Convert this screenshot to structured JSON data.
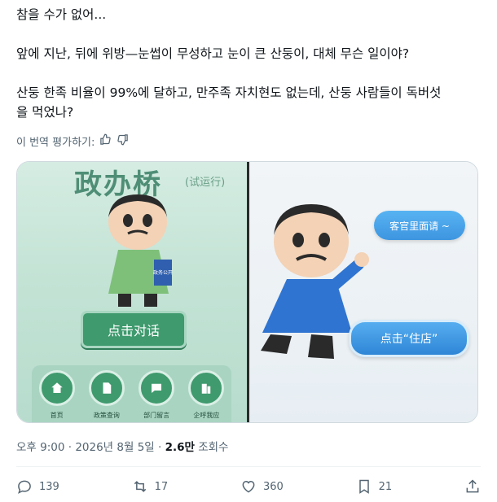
{
  "post": {
    "lines": [
      "참을 수가 없어...",
      "앞에 지난, 뒤에 위방—눈썹이 무성하고 눈이 큰 산둥이, 대체 무슨 일이야?",
      "산둥 한족 비율이 99%에 달하고, 만주족 자치현도 없는데, 산둥 사람들이 독버섯",
      "을 먹었나?"
    ],
    "rate_translation": "이 번역 평가하기:"
  },
  "image_left": {
    "title": "政办桥",
    "subtitle": "(试运行)",
    "book_label": "政务公开",
    "button": "点击对话",
    "nav": [
      {
        "label": "首页",
        "icon": "home-icon"
      },
      {
        "label": "政策查询",
        "icon": "document-icon"
      },
      {
        "label": "部门留言",
        "icon": "chat-icon"
      },
      {
        "label": "企呼我应",
        "icon": "building-icon"
      }
    ]
  },
  "image_right": {
    "bubble_greeting": "客官里面请 ~",
    "bubble_action": "点击“住店”"
  },
  "meta": {
    "time": "오후 9:00 · 2026년 8월 5일 · ",
    "views_count": "2.6만",
    "views_label": " 조회수"
  },
  "actions": {
    "replies": "139",
    "reposts": "17",
    "likes": "360",
    "bookmarks": "21"
  },
  "colors": {
    "accent_green": "#3f9a6e",
    "accent_blue": "#3d95e0",
    "secondary_text": "#536471"
  }
}
